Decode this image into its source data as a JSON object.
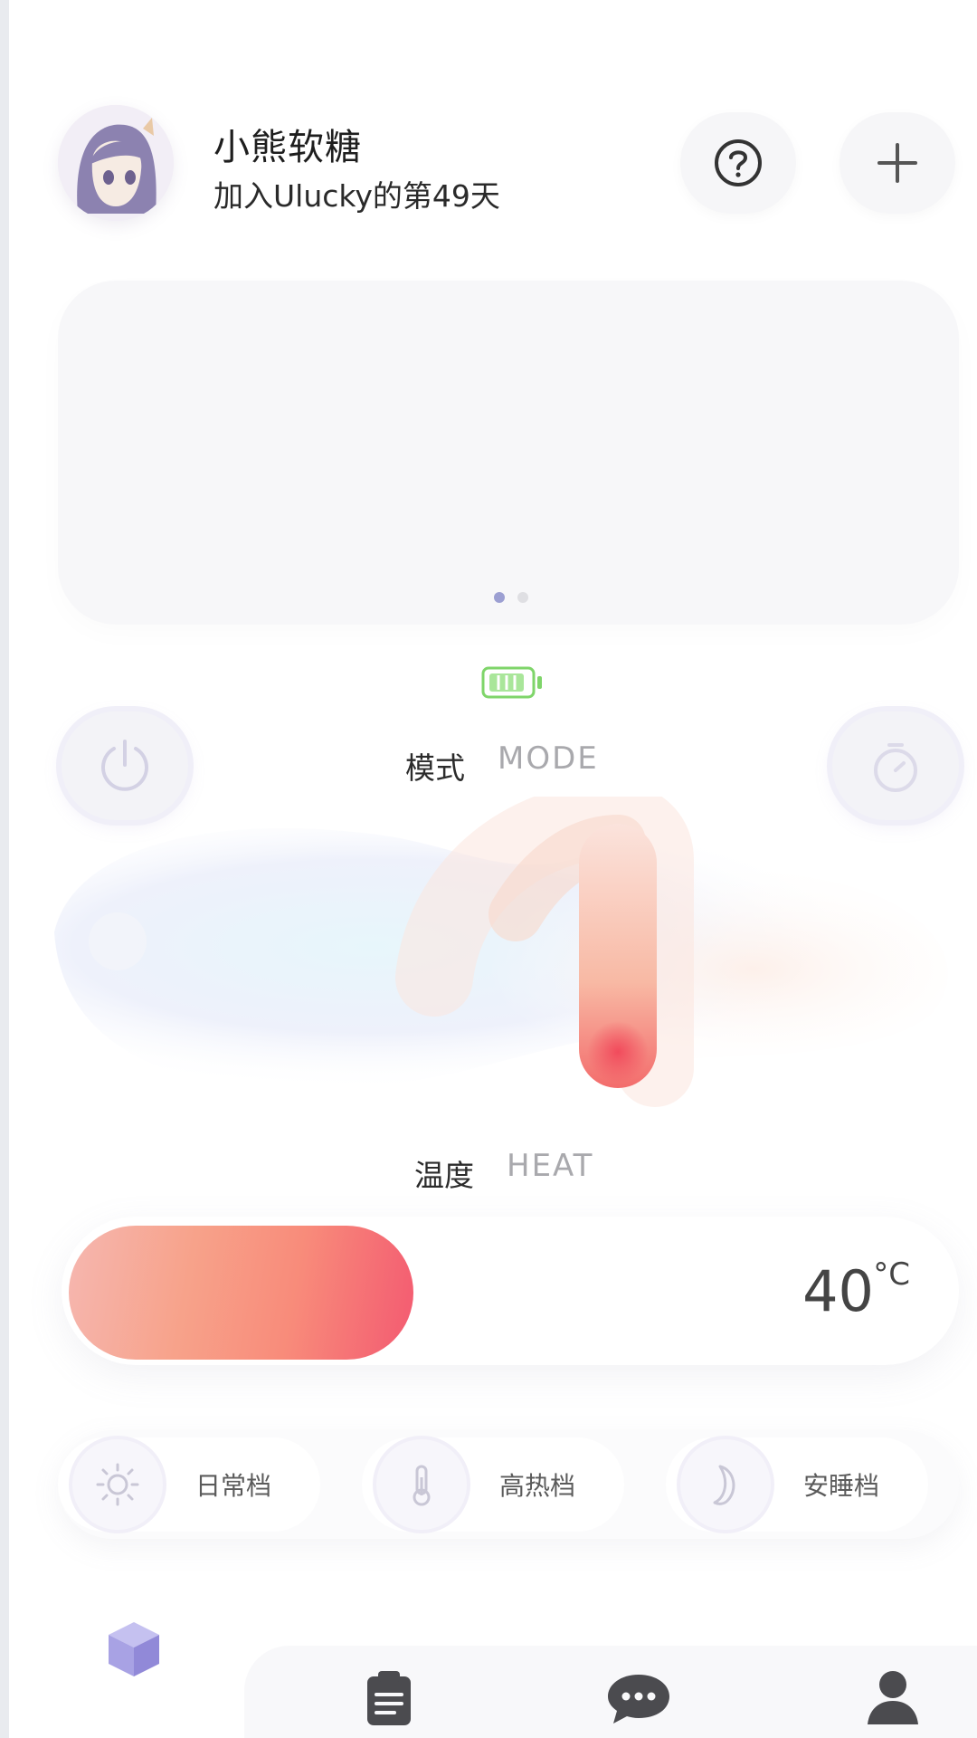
{
  "header": {
    "user_name": "小熊软糖",
    "join_text": "加入Ulucky的第49天",
    "help_icon": "question-circle-icon",
    "add_icon": "plus-icon"
  },
  "banner": {
    "pages": 2,
    "active_page": 1
  },
  "device": {
    "battery_icon": "battery-icon",
    "battery_color": "#7fd56a"
  },
  "mode": {
    "label_cn": "模式",
    "label_en": "MODE",
    "power_icon": "power-icon",
    "timer_icon": "timer-icon"
  },
  "heat": {
    "label_cn": "温度",
    "label_en": "HEAT",
    "value": "40",
    "unit": "°C",
    "fill_fraction": 0.39,
    "gradient_colors": [
      "#f6b7b0",
      "#f88b7a",
      "#f35a71"
    ]
  },
  "presets": [
    {
      "label": "日常档",
      "icon": "sun-icon"
    },
    {
      "label": "高热档",
      "icon": "thermometer-icon"
    },
    {
      "label": "安睡档",
      "icon": "moon-icon"
    }
  ],
  "nav": {
    "items": [
      {
        "name": "home",
        "icon": "cube-icon",
        "active": true
      },
      {
        "name": "records",
        "icon": "clipboard-icon",
        "active": false
      },
      {
        "name": "messages",
        "icon": "chat-icon",
        "active": false
      },
      {
        "name": "profile",
        "icon": "user-icon",
        "active": false
      }
    ],
    "accent_color": "#a8a2e4"
  }
}
